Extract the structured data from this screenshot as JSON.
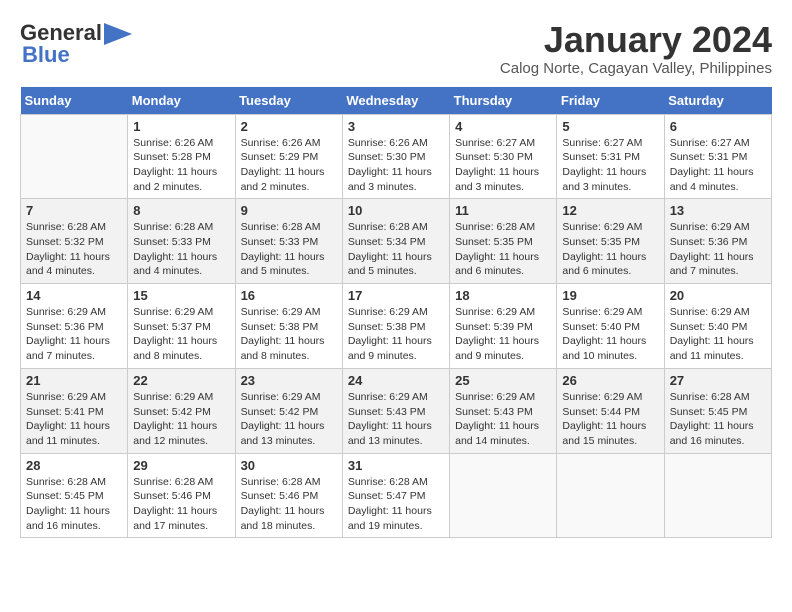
{
  "logo": {
    "general": "General",
    "blue": "Blue"
  },
  "title": "January 2024",
  "subtitle": "Calog Norte, Cagayan Valley, Philippines",
  "weekdays": [
    "Sunday",
    "Monday",
    "Tuesday",
    "Wednesday",
    "Thursday",
    "Friday",
    "Saturday"
  ],
  "weeks": [
    [
      {
        "day": "",
        "sunrise": "",
        "sunset": "",
        "daylight": ""
      },
      {
        "day": "1",
        "sunrise": "Sunrise: 6:26 AM",
        "sunset": "Sunset: 5:28 PM",
        "daylight": "Daylight: 11 hours and 2 minutes."
      },
      {
        "day": "2",
        "sunrise": "Sunrise: 6:26 AM",
        "sunset": "Sunset: 5:29 PM",
        "daylight": "Daylight: 11 hours and 2 minutes."
      },
      {
        "day": "3",
        "sunrise": "Sunrise: 6:26 AM",
        "sunset": "Sunset: 5:30 PM",
        "daylight": "Daylight: 11 hours and 3 minutes."
      },
      {
        "day": "4",
        "sunrise": "Sunrise: 6:27 AM",
        "sunset": "Sunset: 5:30 PM",
        "daylight": "Daylight: 11 hours and 3 minutes."
      },
      {
        "day": "5",
        "sunrise": "Sunrise: 6:27 AM",
        "sunset": "Sunset: 5:31 PM",
        "daylight": "Daylight: 11 hours and 3 minutes."
      },
      {
        "day": "6",
        "sunrise": "Sunrise: 6:27 AM",
        "sunset": "Sunset: 5:31 PM",
        "daylight": "Daylight: 11 hours and 4 minutes."
      }
    ],
    [
      {
        "day": "7",
        "sunrise": "Sunrise: 6:28 AM",
        "sunset": "Sunset: 5:32 PM",
        "daylight": "Daylight: 11 hours and 4 minutes."
      },
      {
        "day": "8",
        "sunrise": "Sunrise: 6:28 AM",
        "sunset": "Sunset: 5:33 PM",
        "daylight": "Daylight: 11 hours and 4 minutes."
      },
      {
        "day": "9",
        "sunrise": "Sunrise: 6:28 AM",
        "sunset": "Sunset: 5:33 PM",
        "daylight": "Daylight: 11 hours and 5 minutes."
      },
      {
        "day": "10",
        "sunrise": "Sunrise: 6:28 AM",
        "sunset": "Sunset: 5:34 PM",
        "daylight": "Daylight: 11 hours and 5 minutes."
      },
      {
        "day": "11",
        "sunrise": "Sunrise: 6:28 AM",
        "sunset": "Sunset: 5:35 PM",
        "daylight": "Daylight: 11 hours and 6 minutes."
      },
      {
        "day": "12",
        "sunrise": "Sunrise: 6:29 AM",
        "sunset": "Sunset: 5:35 PM",
        "daylight": "Daylight: 11 hours and 6 minutes."
      },
      {
        "day": "13",
        "sunrise": "Sunrise: 6:29 AM",
        "sunset": "Sunset: 5:36 PM",
        "daylight": "Daylight: 11 hours and 7 minutes."
      }
    ],
    [
      {
        "day": "14",
        "sunrise": "Sunrise: 6:29 AM",
        "sunset": "Sunset: 5:36 PM",
        "daylight": "Daylight: 11 hours and 7 minutes."
      },
      {
        "day": "15",
        "sunrise": "Sunrise: 6:29 AM",
        "sunset": "Sunset: 5:37 PM",
        "daylight": "Daylight: 11 hours and 8 minutes."
      },
      {
        "day": "16",
        "sunrise": "Sunrise: 6:29 AM",
        "sunset": "Sunset: 5:38 PM",
        "daylight": "Daylight: 11 hours and 8 minutes."
      },
      {
        "day": "17",
        "sunrise": "Sunrise: 6:29 AM",
        "sunset": "Sunset: 5:38 PM",
        "daylight": "Daylight: 11 hours and 9 minutes."
      },
      {
        "day": "18",
        "sunrise": "Sunrise: 6:29 AM",
        "sunset": "Sunset: 5:39 PM",
        "daylight": "Daylight: 11 hours and 9 minutes."
      },
      {
        "day": "19",
        "sunrise": "Sunrise: 6:29 AM",
        "sunset": "Sunset: 5:40 PM",
        "daylight": "Daylight: 11 hours and 10 minutes."
      },
      {
        "day": "20",
        "sunrise": "Sunrise: 6:29 AM",
        "sunset": "Sunset: 5:40 PM",
        "daylight": "Daylight: 11 hours and 11 minutes."
      }
    ],
    [
      {
        "day": "21",
        "sunrise": "Sunrise: 6:29 AM",
        "sunset": "Sunset: 5:41 PM",
        "daylight": "Daylight: 11 hours and 11 minutes."
      },
      {
        "day": "22",
        "sunrise": "Sunrise: 6:29 AM",
        "sunset": "Sunset: 5:42 PM",
        "daylight": "Daylight: 11 hours and 12 minutes."
      },
      {
        "day": "23",
        "sunrise": "Sunrise: 6:29 AM",
        "sunset": "Sunset: 5:42 PM",
        "daylight": "Daylight: 11 hours and 13 minutes."
      },
      {
        "day": "24",
        "sunrise": "Sunrise: 6:29 AM",
        "sunset": "Sunset: 5:43 PM",
        "daylight": "Daylight: 11 hours and 13 minutes."
      },
      {
        "day": "25",
        "sunrise": "Sunrise: 6:29 AM",
        "sunset": "Sunset: 5:43 PM",
        "daylight": "Daylight: 11 hours and 14 minutes."
      },
      {
        "day": "26",
        "sunrise": "Sunrise: 6:29 AM",
        "sunset": "Sunset: 5:44 PM",
        "daylight": "Daylight: 11 hours and 15 minutes."
      },
      {
        "day": "27",
        "sunrise": "Sunrise: 6:28 AM",
        "sunset": "Sunset: 5:45 PM",
        "daylight": "Daylight: 11 hours and 16 minutes."
      }
    ],
    [
      {
        "day": "28",
        "sunrise": "Sunrise: 6:28 AM",
        "sunset": "Sunset: 5:45 PM",
        "daylight": "Daylight: 11 hours and 16 minutes."
      },
      {
        "day": "29",
        "sunrise": "Sunrise: 6:28 AM",
        "sunset": "Sunset: 5:46 PM",
        "daylight": "Daylight: 11 hours and 17 minutes."
      },
      {
        "day": "30",
        "sunrise": "Sunrise: 6:28 AM",
        "sunset": "Sunset: 5:46 PM",
        "daylight": "Daylight: 11 hours and 18 minutes."
      },
      {
        "day": "31",
        "sunrise": "Sunrise: 6:28 AM",
        "sunset": "Sunset: 5:47 PM",
        "daylight": "Daylight: 11 hours and 19 minutes."
      },
      {
        "day": "",
        "sunrise": "",
        "sunset": "",
        "daylight": ""
      },
      {
        "day": "",
        "sunrise": "",
        "sunset": "",
        "daylight": ""
      },
      {
        "day": "",
        "sunrise": "",
        "sunset": "",
        "daylight": ""
      }
    ]
  ]
}
